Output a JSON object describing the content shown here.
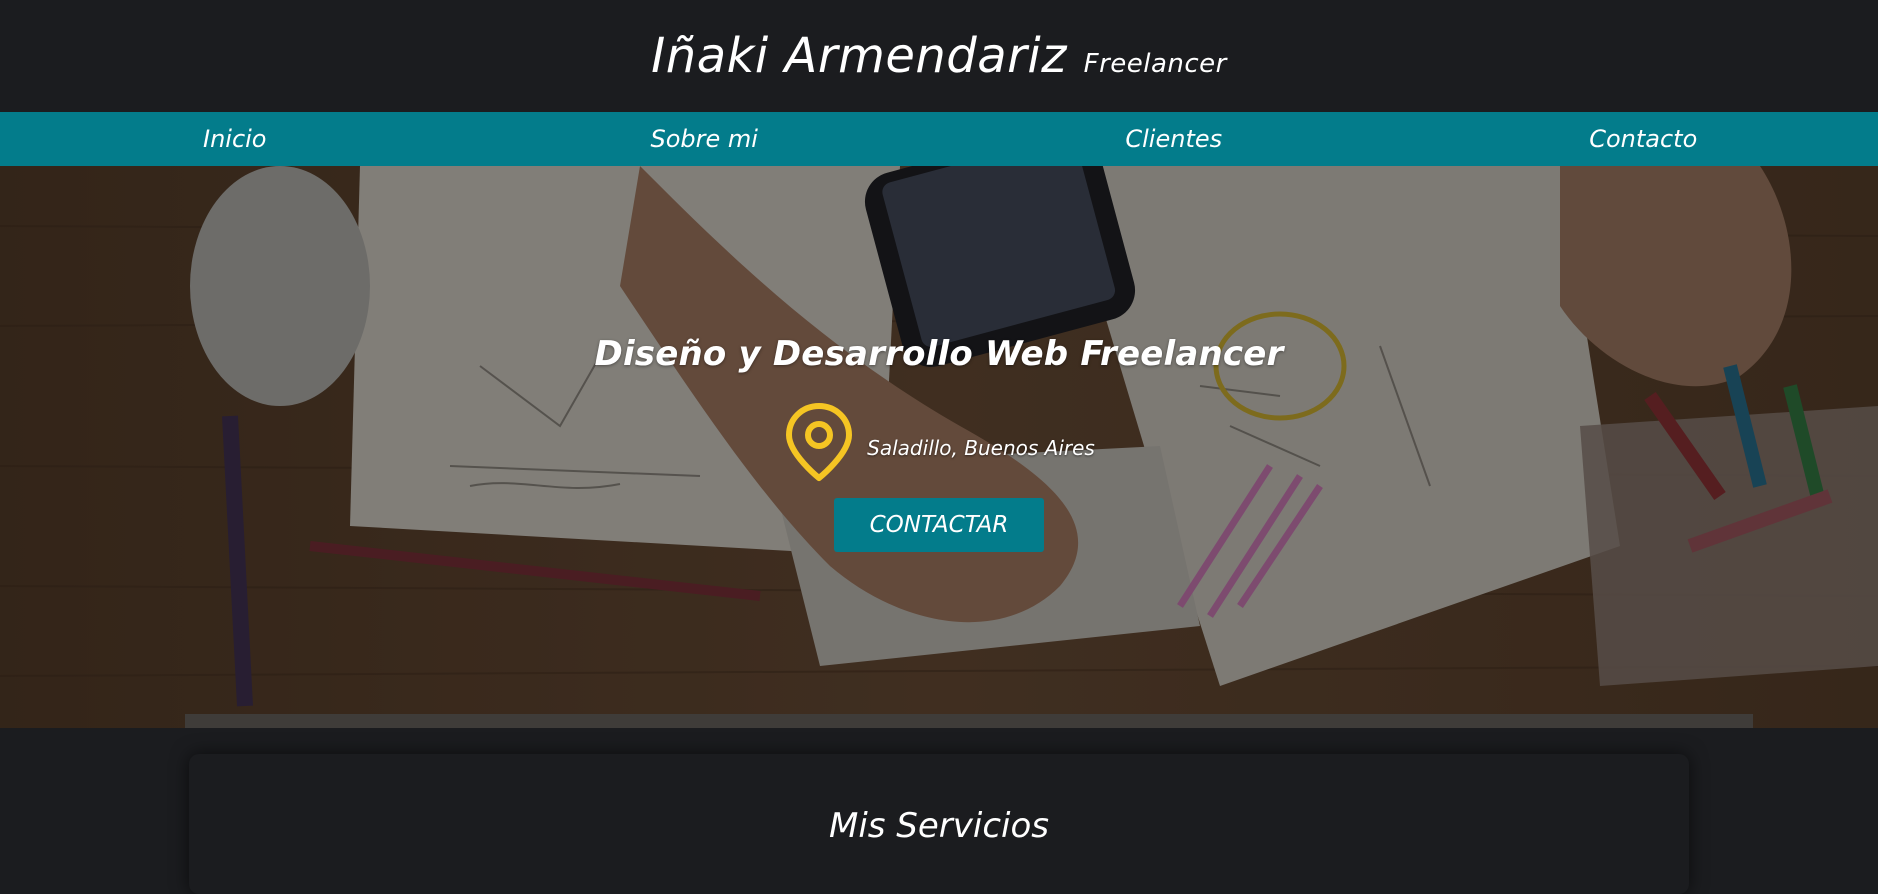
{
  "header": {
    "name": "Iñaki Armendariz",
    "tagline": "Freelancer"
  },
  "nav": {
    "items": [
      {
        "label": "Inicio"
      },
      {
        "label": "Sobre mi"
      },
      {
        "label": "Clientes"
      },
      {
        "label": "Contacto"
      }
    ]
  },
  "hero": {
    "title": "Diseño y Desarrollo Web Freelancer",
    "location": "Saladillo, Buenos Aires",
    "location_icon": "map-pin-icon",
    "cta_label": "CONTACTAR"
  },
  "services": {
    "title": "Mis Servicios"
  },
  "colors": {
    "background": "#1b1c1f",
    "accent": "#037c8b",
    "pin": "#f5c523",
    "text": "#ffffff"
  }
}
